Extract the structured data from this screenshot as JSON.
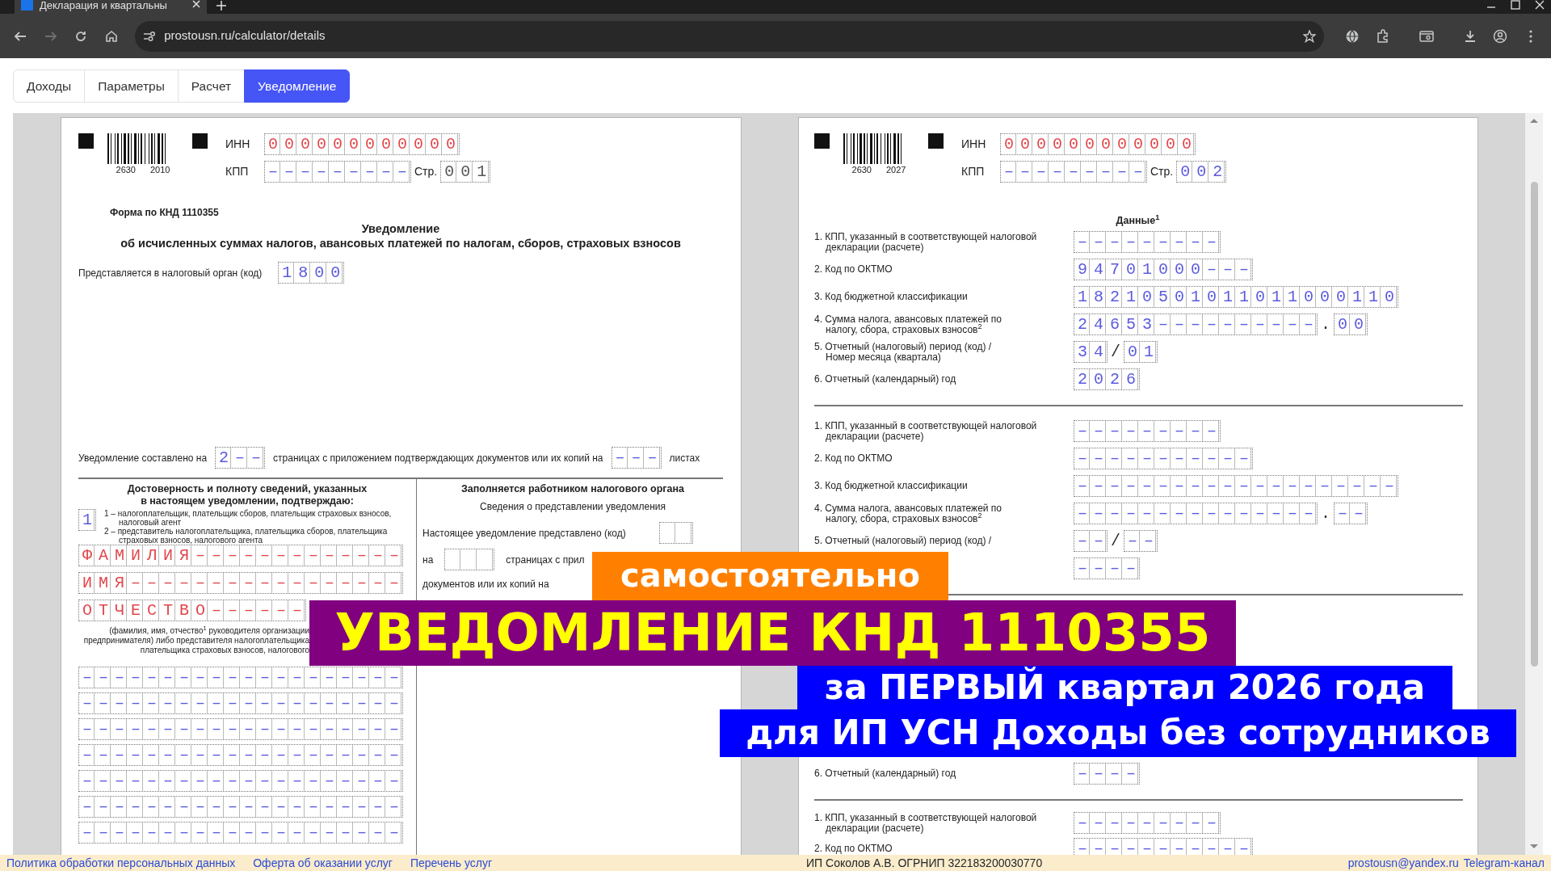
{
  "browser": {
    "tab_title": "Декларация и квартальны",
    "url": "prostousn.ru/calculator/details"
  },
  "tabs": [
    {
      "label": "Доходы",
      "selected": false
    },
    {
      "label": "Параметры",
      "selected": false
    },
    {
      "label": "Расчет",
      "selected": false
    },
    {
      "label": "Уведомление",
      "selected": true
    }
  ],
  "notice_page": {
    "header": {
      "barcode": [
        "2630",
        "2010"
      ],
      "inn_label": "ИНН",
      "inn": {
        "value": "000000000000",
        "color": "#e2474c"
      },
      "kpp_label": "КПП",
      "kpp": {
        "value": "–––––––––",
        "color": "#5b5bdf"
      },
      "page_label": "Стр.",
      "page_no": {
        "value": "001",
        "color": "#555555"
      }
    },
    "form_code": "Форма по КНД 1110355",
    "title": "Уведомление",
    "subtitle": "об исчисленных суммах налогов, авансовых платежей по налогам, сборов, страховых взносов",
    "authority_label": "Представляется в налоговый орган (код)",
    "authority_code": {
      "value": "1800",
      "color": "#5b5bdf"
    },
    "pages_line": {
      "text_1": "Уведомление составлено на",
      "pages": {
        "value": "2––",
        "color": "#5b5bdf"
      },
      "text_2": "страницах с приложением подтверждающих документов или их копий на",
      "sheets": {
        "value": "–––",
        "color": "#5b5bdf"
      },
      "text_3": "листах"
    },
    "confirmation": {
      "heading": [
        "Достоверность и полноту сведений, указанных",
        "в настоящем уведомлении, подтверждаю:"
      ],
      "signer": {
        "value": "1",
        "color": "#5b5bdf"
      },
      "options": [
        [
          "1 – налогоплательщик, плательщик сборов, плательщик страховых взносов,",
          "налоговый агент"
        ],
        [
          "2 – представитель налогоплательщика, плательщика сборов, плательщика",
          "страховых взносов, налогового агента"
        ]
      ],
      "name_fields": [
        {
          "value": "ФАМИЛИЯ–––––––––––––",
          "color": "#e2474c"
        },
        {
          "value": "ИМЯ–––––––––––––––––",
          "color": "#e2474c"
        },
        {
          "value": "ОТЧЕСТВО––––––",
          "color": "#e2474c"
        }
      ],
      "caption": [
        "(фамилия, имя, отчество$^{1}$ руководителя организации",
        "предпринимателя) либо представителя налогоплательщика",
        "плательщика страховых взносов, налогового"
      ],
      "lines": [
        {
          "value": "––––––––––––––––––––",
          "color": "#5b5bdf"
        },
        {
          "value": "––––––––––––––––––––",
          "color": "#5b5bdf"
        },
        {
          "value": "––––––––––––––––––––",
          "color": "#5b5bdf"
        },
        {
          "value": "––––––––––––––––––––",
          "color": "#5b5bdf"
        },
        {
          "value": "––––––––––––––––––––",
          "color": "#5b5bdf"
        },
        {
          "value": "––––––––––––––––––––",
          "color": "#5b5bdf"
        },
        {
          "value": "––––––––––––––––––––",
          "color": "#5b5bdf"
        }
      ]
    },
    "office": {
      "heading": "Заполняется работником налогового органа",
      "subtitle": "Сведения о представлении уведомления",
      "code_label": "Настоящее уведомление представлено (код)",
      "pages_label": "на",
      "pages_text": "страницах с прил",
      "copies_label": "документов или их копий на"
    }
  },
  "data_page": {
    "header": {
      "barcode": [
        "2630",
        "2027"
      ],
      "inn_label": "ИНН",
      "inn": {
        "value": "000000000000",
        "color": "#e2474c"
      },
      "kpp_label": "КПП",
      "kpp": {
        "value": "–––––––––",
        "color": "#5b5bdf"
      },
      "page_label": "Стр.",
      "page_no": {
        "value": "002",
        "color": "#5b5bdf"
      }
    },
    "heading": "Данные$^{1}$",
    "blocks": [
      {
        "rows": [
          {
            "label": [
              "1. КПП, указанный в соответствующей налоговой",
              "декларации (расчете)"
            ],
            "parts": [
              {
                "kind": "cells",
                "value": "–––––––––",
                "color": "#5b5bdf"
              }
            ]
          },
          {
            "label": [
              "2. Код по ОКТМО"
            ],
            "parts": [
              {
                "kind": "cells",
                "value": "94701000–––",
                "color": "#5b5bdf"
              }
            ]
          },
          {
            "label": [
              "3. Код бюджетной классификации"
            ],
            "parts": [
              {
                "kind": "cells",
                "value": "18210501011011000110",
                "color": "#5b5bdf"
              }
            ]
          },
          {
            "label": [
              "4. Сумма налога, авансовых платежей по",
              "налогу, сбора, страховых взносов$^{2}$"
            ],
            "parts": [
              {
                "kind": "cells",
                "value": "24653––––––––––",
                "color": "#5b5bdf"
              },
              {
                "kind": "text",
                "text": "."
              },
              {
                "kind": "cells",
                "value": "00",
                "color": "#5b5bdf"
              }
            ]
          },
          {
            "label": [
              "5. Отчетный (налоговый) период (код) /",
              "Номер месяца (квартала)"
            ],
            "parts": [
              {
                "kind": "cells",
                "value": "34",
                "color": "#5b5bdf"
              },
              {
                "kind": "text",
                "text": "/"
              },
              {
                "kind": "cells",
                "value": "01",
                "color": "#5b5bdf"
              }
            ]
          },
          {
            "label": [
              "6. Отчетный (календарный) год"
            ],
            "parts": [
              {
                "kind": "cells",
                "value": "2026",
                "color": "#5b5bdf"
              }
            ]
          }
        ]
      },
      {
        "rows": [
          {
            "label": [
              "1. КПП, указанный в соответствующей налоговой",
              "декларации (расчете)"
            ],
            "parts": [
              {
                "kind": "cells",
                "value": "–––––––––",
                "color": "#5b5bdf"
              }
            ]
          },
          {
            "label": [
              "2. Код по ОКТМО"
            ],
            "parts": [
              {
                "kind": "cells",
                "value": "–––––––––––",
                "color": "#5b5bdf"
              }
            ]
          },
          {
            "label": [
              "3. Код бюджетной классификации"
            ],
            "parts": [
              {
                "kind": "cells",
                "value": "––––––––––––––––––––",
                "color": "#5b5bdf"
              }
            ]
          },
          {
            "label": [
              "4. Сумма налога, авансовых платежей по",
              "налогу, сбора, страховых взносов$^{2}$"
            ],
            "parts": [
              {
                "kind": "cells",
                "value": "–––––––––––––––",
                "color": "#5b5bdf"
              },
              {
                "kind": "text",
                "text": "."
              },
              {
                "kind": "cells",
                "value": "––",
                "color": "#5b5bdf"
              }
            ]
          },
          {
            "label": [
              "5. Отчетный (налоговый) период (код) /"
            ],
            "parts": [
              {
                "kind": "cells",
                "value": "––",
                "color": "#5b5bdf"
              },
              {
                "kind": "text",
                "text": "/"
              },
              {
                "kind": "cells",
                "value": "––",
                "color": "#5b5bdf"
              }
            ]
          },
          {
            "parts": [
              {
                "kind": "cells",
                "value": "––––",
                "color": "#5b5bdf"
              }
            ]
          }
        ]
      },
      {
        "rows": [
          {
            "label": [
              "6. Отчетный (календарный) год"
            ],
            "parts": [
              {
                "kind": "cells",
                "value": "––––",
                "color": "#5b5bdf"
              }
            ]
          }
        ]
      },
      {
        "rows": [
          {
            "label": [
              "1. КПП, указанный в соответствующей налоговой",
              "декларации (расчете)"
            ],
            "parts": [
              {
                "kind": "cells",
                "value": "–––––––––",
                "color": "#5b5bdf"
              }
            ]
          },
          {
            "label": [
              "2. Код по ОКТМО"
            ],
            "parts": [
              {
                "kind": "cells",
                "value": "–––––––––––",
                "color": "#5b5bdf"
              }
            ]
          }
        ]
      }
    ]
  },
  "overlay": [
    {
      "kind": "tag",
      "text": "самостоятельно"
    },
    {
      "kind": "title",
      "text": "УВЕДОМЛЕНИЕ КНД 1110355"
    },
    {
      "kind": "caption",
      "text": "за ПЕРВЫЙ квартал 2026 года"
    },
    {
      "kind": "caption",
      "text": "для ИП УСН Доходы без сотрудников"
    }
  ],
  "footer": {
    "links": [
      "Политика обработки персональных данных",
      "Оферта об оказании услуг",
      "Перечень услуг"
    ],
    "owner": "ИП Соколов А.В. ОГРНИП 322183200030770",
    "contacts": [
      "prostousn@yandex.ru",
      "Telegram-канал"
    ]
  }
}
